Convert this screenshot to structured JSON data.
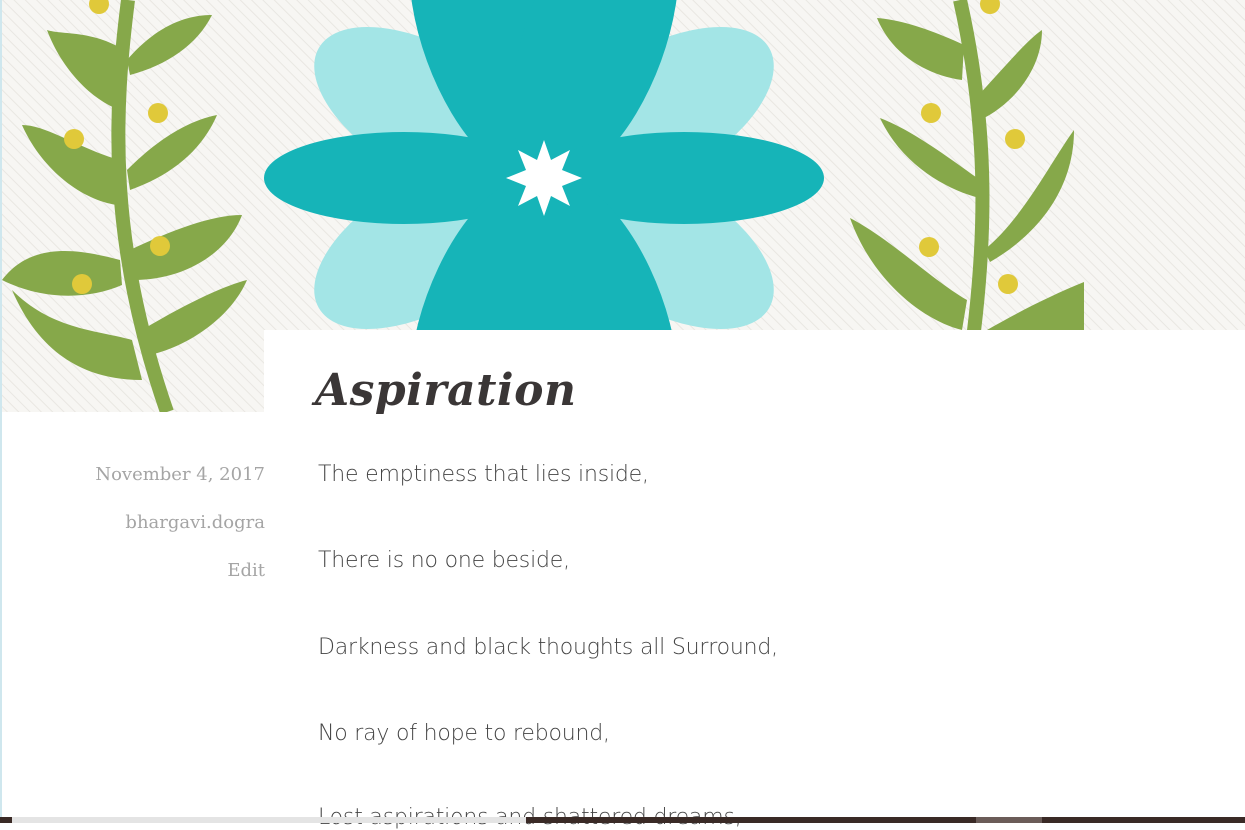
{
  "post": {
    "title": "Aspiration",
    "date": "November 4, 2017",
    "author": "bhargavi.dogra",
    "edit_label": "Edit",
    "lines": [
      "The emptiness that lies inside,",
      "There is no one beside,",
      "Darkness and black thoughts all Surround,",
      "No ray of hope to rebound,",
      "Lost aspirations and shattered dreams,"
    ]
  },
  "colors": {
    "leaf_green": "#86a84a",
    "berry_yellow": "#e0c93a",
    "petal_teal": "#16b4b8",
    "petal_light": "#a3e5e6",
    "title_text": "#3a3636",
    "meta_text": "#a5a5a5",
    "body_text": "#444444"
  }
}
